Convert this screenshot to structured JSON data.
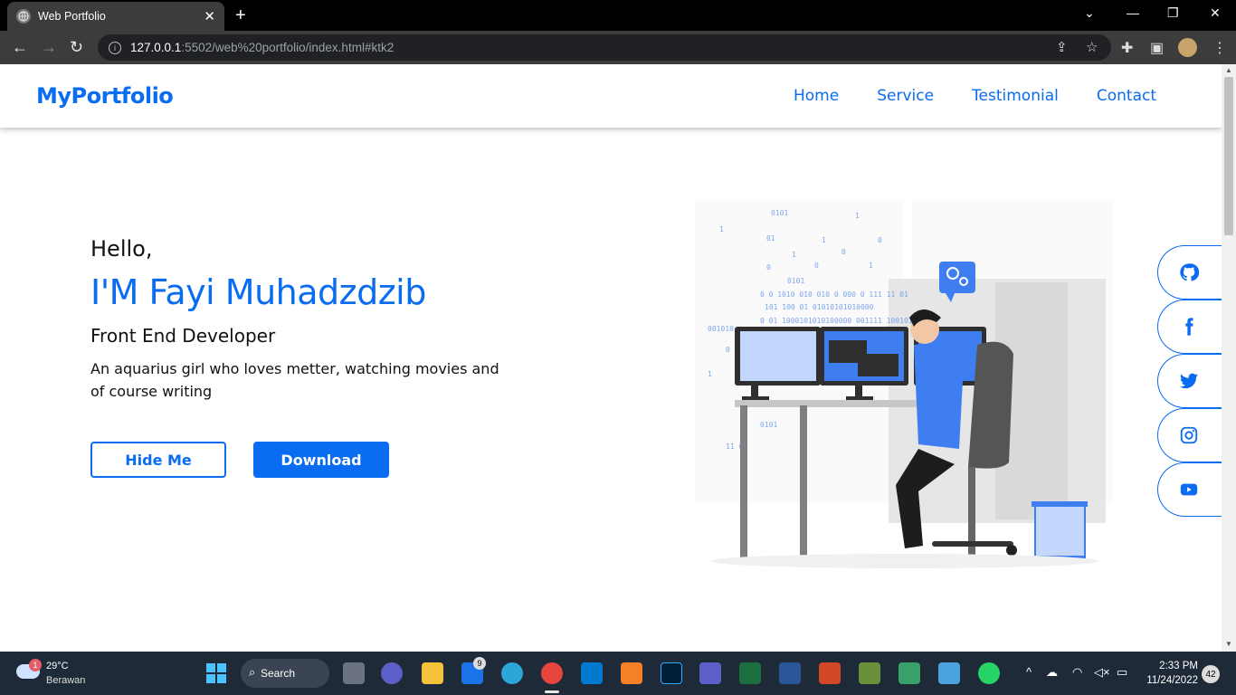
{
  "browser": {
    "tab_title": "Web Portfolio",
    "tab_close": "✕",
    "new_tab": "+",
    "url_host": "127.0.0.1",
    "url_rest": ":5502/web%20portfolio/index.html#ktk2",
    "icons": [
      "back-icon",
      "forward-icon",
      "reload-icon",
      "info-icon",
      "share-icon",
      "star-icon",
      "extensions-icon",
      "sidepanel-icon",
      "profile-icon",
      "menu-icon"
    ]
  },
  "site": {
    "brand": "MyPortfolio",
    "nav": [
      "Home",
      "Service",
      "Testimonial",
      "Contact"
    ],
    "hello": "Hello,",
    "name": "I'M Fayi Muhadzdzib",
    "role": "Front End Developer",
    "description": "An aquarius girl who loves metter, watching movies and of course writing",
    "btn_hide": "Hide Me",
    "btn_download": "Download",
    "social": [
      "github-icon",
      "facebook-icon",
      "twitter-icon",
      "instagram-icon",
      "youtube-icon"
    ],
    "accent": "#0a6cf0"
  },
  "taskbar": {
    "weather_badge": "1",
    "temperature": "29°C",
    "weather_text": "Berawan",
    "search": "Search",
    "mail_badge": "9",
    "time": "2:33 PM",
    "date": "11/24/2022",
    "notifications": "42"
  }
}
